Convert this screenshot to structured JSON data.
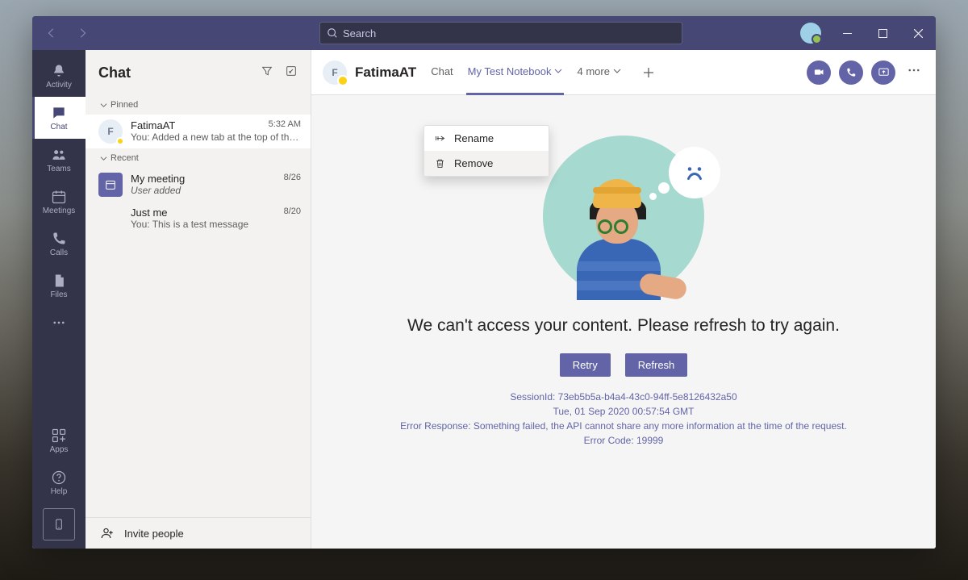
{
  "search": {
    "placeholder": "Search"
  },
  "rail": {
    "items": [
      {
        "id": "activity",
        "label": "Activity"
      },
      {
        "id": "chat",
        "label": "Chat"
      },
      {
        "id": "teams",
        "label": "Teams"
      },
      {
        "id": "meetings",
        "label": "Meetings"
      },
      {
        "id": "calls",
        "label": "Calls"
      },
      {
        "id": "files",
        "label": "Files"
      }
    ],
    "apps": "Apps",
    "help": "Help"
  },
  "chatlist": {
    "title": "Chat",
    "sections": {
      "pinned": "Pinned",
      "recent": "Recent"
    },
    "pinned": [
      {
        "name": "FatimaAT",
        "time": "5:32 AM",
        "preview": "You: Added a new tab at the top of this...",
        "initial": "F"
      }
    ],
    "recent": [
      {
        "name": "My meeting",
        "time": "8/26",
        "preview": "User added",
        "italic": true,
        "cal": true
      },
      {
        "name": "Just me",
        "time": "8/20",
        "preview": "You: This is a test message"
      }
    ],
    "invite": "Invite people"
  },
  "chatHeader": {
    "initial": "F",
    "title": "FatimaAT",
    "tabs": {
      "chat": "Chat",
      "notebook": "My Test Notebook",
      "more": "4 more"
    }
  },
  "ctx": {
    "rename": "Rename",
    "remove": "Remove"
  },
  "error": {
    "title": "We can't access your content. Please refresh to try again.",
    "retry": "Retry",
    "refresh": "Refresh",
    "session": "SessionId: 73eb5b5a-b4a4-43c0-94ff-5e8126432a50",
    "timestamp": "Tue, 01 Sep 2020 00:57:54 GMT",
    "response": "Error Response: Something failed, the API cannot share any more information at the time of the request.",
    "code": "Error Code: 19999"
  }
}
